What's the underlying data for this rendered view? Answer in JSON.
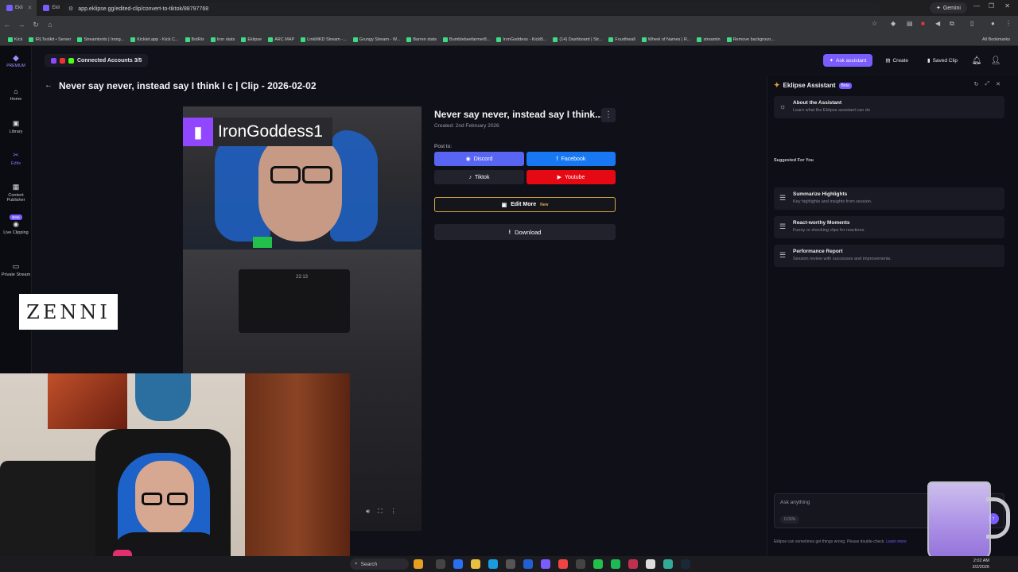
{
  "browser": {
    "tab_label": "Ekli",
    "tab_count": 22,
    "gemini_label": "Gemini",
    "url": "app.eklipse.gg/edited-clip/convert-to-tiktok/88797768",
    "bookmarks": [
      "Kick",
      "IRLToolkit • Server",
      "Streamloots | Irong...",
      "Kicklet.app - Kick C...",
      "BotRix",
      "Iron stats",
      "Eklipse",
      "ARC MAP",
      "LinkMKD Stream -...",
      "Grungy Stream - W...",
      "Barren stats",
      "Bumblebeefarmer8...",
      "IronGoddess - KickB...",
      "(14) Dashboard | Str...",
      "Fourthwall",
      "Wheel of Names | R...",
      "streamin",
      "Remove backgroun..."
    ],
    "all_bookmarks": "All Bookmarks"
  },
  "sidebar": {
    "premium": "PREMIUM",
    "items": [
      {
        "label": "Home"
      },
      {
        "label": "Library"
      },
      {
        "label": "Edits"
      },
      {
        "label": "Content Publisher"
      },
      {
        "label": "Live Clipping",
        "badge": "Beta"
      },
      {
        "label": "Private Stream"
      }
    ]
  },
  "topbar": {
    "connected": "Connected Accounts 3/5",
    "ask": "Ask assistant",
    "create": "Create",
    "saved": "Saved Clip"
  },
  "page": {
    "title": "Never say never, instead say I think I c | Clip - 2026-02-02"
  },
  "video": {
    "banner": "IronGoddess1",
    "clock": "22:13"
  },
  "clip": {
    "title": "Never say never, instead say I think...",
    "created": "Created: 2nd February 2026",
    "post_to": "Post to:",
    "discord": "Discord",
    "facebook": "Facebook",
    "tiktok": "Tiktok",
    "youtube": "Youtube",
    "edit_more": "Edit More",
    "new_tag": "New",
    "download": "Download"
  },
  "assistant": {
    "title": "Eklipse Assistant",
    "beta": "Beta",
    "about_title": "About the Assistant",
    "about_sub": "Learn what the Eklipse assistant can do",
    "suggested": "Suggested For You",
    "cards": [
      {
        "title": "Summarize Highlights",
        "sub": "Key highlights and insights from session."
      },
      {
        "title": "React-worthy Moments",
        "sub": "Funny or shocking clips for reactions."
      },
      {
        "title": "Performance Report",
        "sub": "Session review with successes and improvements."
      }
    ],
    "ask_placeholder": "Ask anything",
    "pct": "0.00%",
    "disclaimer": "Eklipse can sometimes get things wrong. Please double-check.",
    "learn": "Learn more"
  },
  "overlay": {
    "zenni": "ZENNI"
  },
  "taskbar": {
    "search": "Search",
    "time": "2:02 AM",
    "date": "2/2/2026"
  },
  "colors": {
    "accent": "#7a5cff",
    "discord": "#5865f2",
    "facebook": "#1877f2",
    "youtube": "#e50914",
    "edit_border": "#d8a640"
  }
}
